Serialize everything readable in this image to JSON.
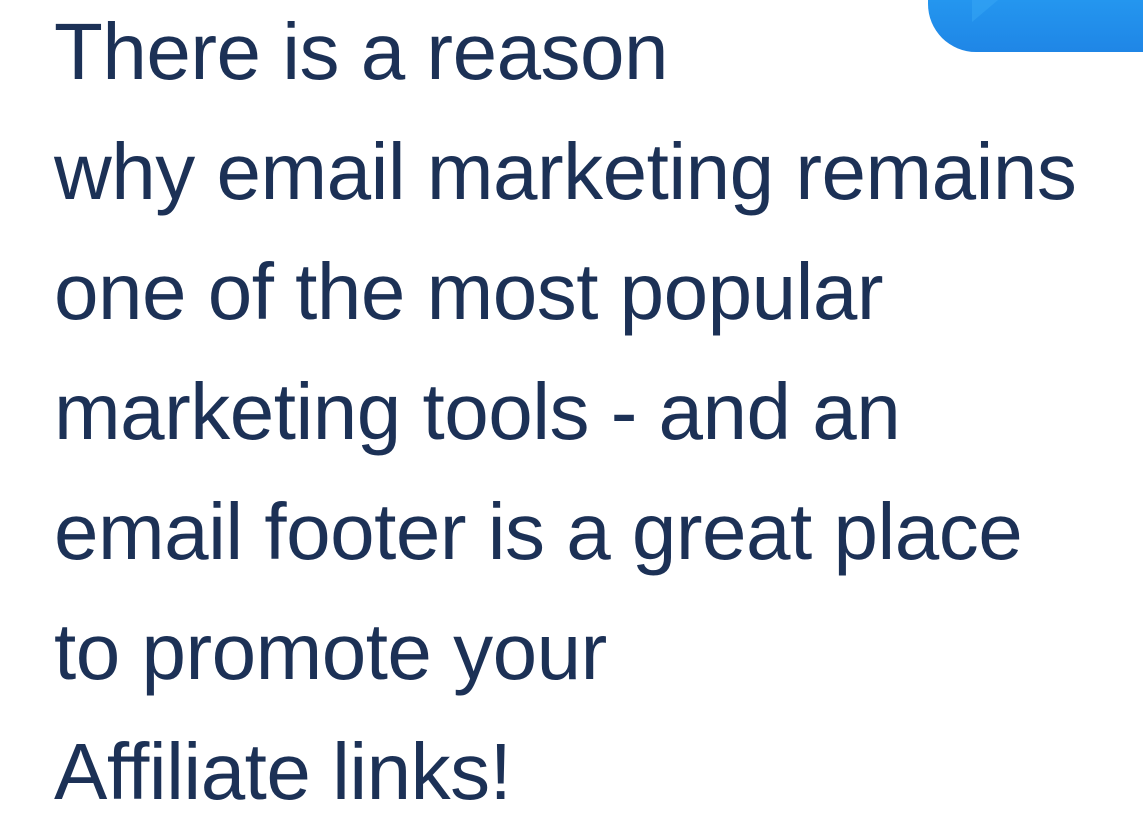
{
  "accent_color": "#1f86e6",
  "text_color": "#1c3156",
  "message": {
    "lines": [
      "There is a reason",
      "why email marketing remains",
      "one of the most popular",
      "marketing tools - and an",
      "email footer is a great place",
      "to promote your",
      "Affiliate links!"
    ]
  }
}
